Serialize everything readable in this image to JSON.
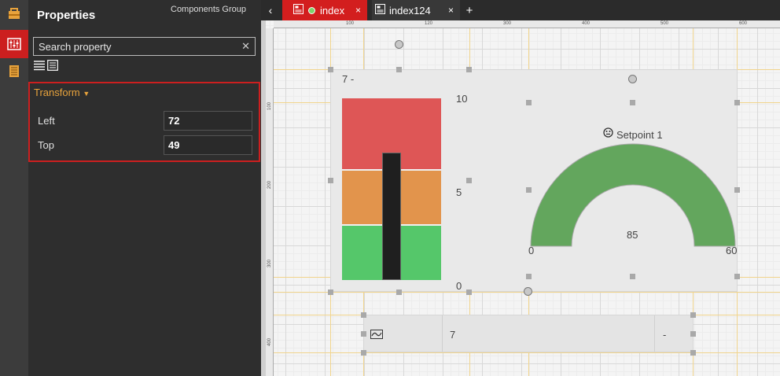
{
  "panel": {
    "title": "Properties",
    "group_label": "Components Group",
    "search_placeholder": "Search property",
    "transform": {
      "title": "Transform",
      "left_label": "Left",
      "left_value": "72",
      "top_label": "Top",
      "top_value": "49"
    }
  },
  "tabs": [
    {
      "label": "index",
      "active": true,
      "close": "×"
    },
    {
      "label": "index124",
      "active": false,
      "close": "×"
    }
  ],
  "add_tab": "+",
  "collapse": "‹",
  "ruler": {
    "top_labels": [
      "100",
      "120",
      "300",
      "400",
      "500",
      "600"
    ],
    "left_labels": [
      "100",
      "200",
      "300",
      "400"
    ]
  },
  "bar_widget": {
    "value_text": "7 -",
    "scale_max": "10",
    "scale_mid": "5",
    "scale_min": "0",
    "value": 7,
    "max": 10,
    "colors": {
      "high": "#de5656",
      "mid": "#e2944c",
      "low": "#55c76a"
    }
  },
  "gauge_widget": {
    "title": "Setpoint 1",
    "value": "85",
    "min_label": "0",
    "max_label": "60",
    "color": "#63a65d"
  },
  "value_box": {
    "value": "7",
    "unit": "-"
  }
}
